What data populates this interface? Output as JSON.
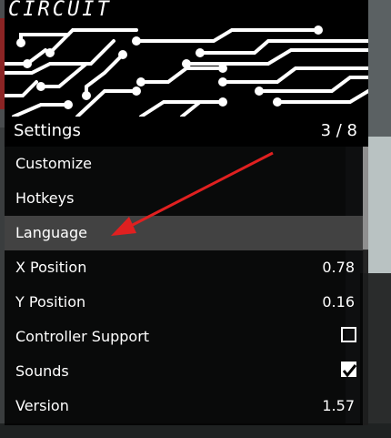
{
  "banner": {
    "title": "CIRCUIT"
  },
  "header": {
    "title": "Settings",
    "counter": "3 / 8"
  },
  "items": [
    {
      "label": "Customize",
      "value": ""
    },
    {
      "label": "Hotkeys",
      "value": ""
    },
    {
      "label": "Language",
      "value": ""
    },
    {
      "label": "X Position",
      "value": "0.78"
    },
    {
      "label": "Y Position",
      "value": "0.16"
    },
    {
      "label": "Controller Support",
      "checked": false
    },
    {
      "label": "Sounds",
      "checked": true
    },
    {
      "label": "Version",
      "value": "1.57"
    }
  ],
  "selected_index": 2,
  "colors": {
    "annotation_arrow": "#e02020",
    "highlight": "#464646",
    "panel": "#000000"
  },
  "icons": [
    "circuit-pattern-icon",
    "checkbox-icon",
    "checkmark-icon",
    "arrow-annotation-icon"
  ]
}
